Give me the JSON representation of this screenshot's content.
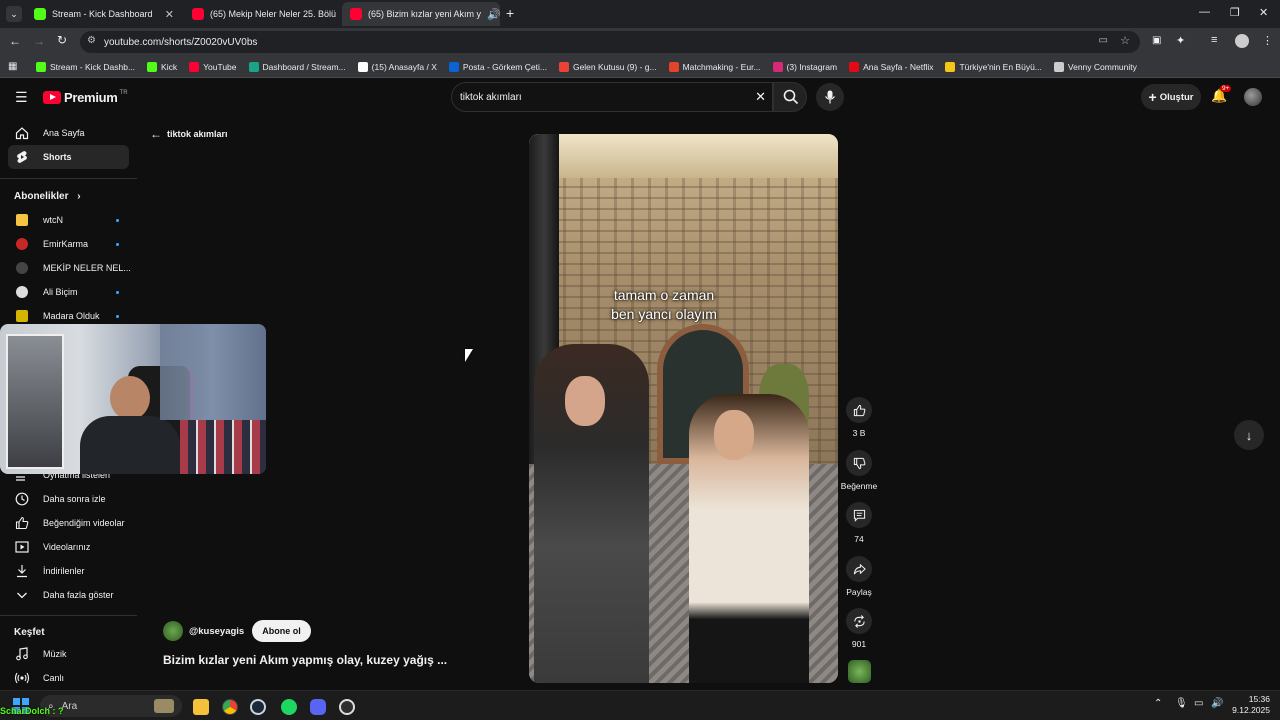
{
  "browser": {
    "tabs": [
      {
        "label": "Stream - Kick Dashboard",
        "color": "#53fc18"
      },
      {
        "label": "(65) Mekip Neler Neler 25. Bölü",
        "color": "#ff0033"
      },
      {
        "label": "(65) Bizim kızlar yeni Akım y",
        "color": "#ff0033"
      }
    ],
    "url": "youtube.com/shorts/Z0020vUV0bs",
    "bookmarks": [
      {
        "label": "Stream - Kick Dashb...",
        "color": "#53fc18"
      },
      {
        "label": "Kick",
        "color": "#53fc18"
      },
      {
        "label": "YouTube",
        "color": "#ff0033"
      },
      {
        "label": "Dashboard / Stream...",
        "color": "#1da28a"
      },
      {
        "label": "(15) Anasayfa / X",
        "color": "#ffffff"
      },
      {
        "label": "Posta - Görkem Çeti...",
        "color": "#0a64d6"
      },
      {
        "label": "Gelen Kutusu (9) - g...",
        "color": "#ea4335"
      },
      {
        "label": "Matchmaking - Eur...",
        "color": "#e24329"
      },
      {
        "label": "(3) Instagram",
        "color": "#d62976"
      },
      {
        "label": "Ana Sayfa - Netflix",
        "color": "#e50914"
      },
      {
        "label": "Türkiye'nin En Büyü...",
        "color": "#f5c518"
      },
      {
        "label": "Venny Community",
        "color": "#cccccc"
      }
    ]
  },
  "header": {
    "logo": "Premium",
    "logo_sup": "TR",
    "search_value": "tiktok akımları",
    "create_label": "Oluştur",
    "notif_badge": "9+"
  },
  "sidebar": {
    "main": [
      {
        "label": "Ana Sayfa",
        "icon": "home-icon"
      },
      {
        "label": "Shorts",
        "icon": "shorts-icon"
      }
    ],
    "subs_title": "Abonelikler",
    "subs": [
      {
        "label": "wtcN",
        "color": "#f4c542"
      },
      {
        "label": "EmirKarma",
        "color": "#c62828"
      },
      {
        "label": "MEKİP NELER NEL...",
        "color": "#444444"
      },
      {
        "label": "Ali Biçim",
        "color": "#dddddd"
      },
      {
        "label": "Madara Olduk",
        "color": "#d4b400"
      }
    ],
    "you": [
      {
        "label": "Oynatma listeleri",
        "icon": "playlist-icon"
      },
      {
        "label": "Daha sonra izle",
        "icon": "clock-icon"
      },
      {
        "label": "Beğendiğim videolar",
        "icon": "like-icon"
      },
      {
        "label": "Videolarınız",
        "icon": "video-icon"
      },
      {
        "label": "İndirilenler",
        "icon": "download-icon"
      },
      {
        "label": "Daha fazla göster",
        "icon": "chevron-down-icon"
      }
    ],
    "explore_title": "Keşfet",
    "explore": [
      {
        "label": "Müzik",
        "icon": "music-icon"
      },
      {
        "label": "Canlı",
        "icon": "live-icon"
      }
    ]
  },
  "shorts": {
    "back_label": "tiktok akımları",
    "caption_line1": "tamam o zaman",
    "caption_line2": "ben yancı olayım",
    "channel": "@kuseyagis",
    "subscribe_label": "Abone ol",
    "title": "Bizim kızlar yeni Akım yapmış olay, kuzey yağış ...",
    "likes": "3 B",
    "dislike_label": "Beğenme",
    "comments": "74",
    "share_label": "Paylaş",
    "remix": "901"
  },
  "taskbar": {
    "search_placeholder": "Ara",
    "time": "15:36",
    "date": "9.12.2025",
    "overlay_text": "ScharDolch : ?"
  },
  "colors": {
    "background": "#0f0f0f",
    "yt_red": "#ff0033",
    "surface": "#272727"
  }
}
